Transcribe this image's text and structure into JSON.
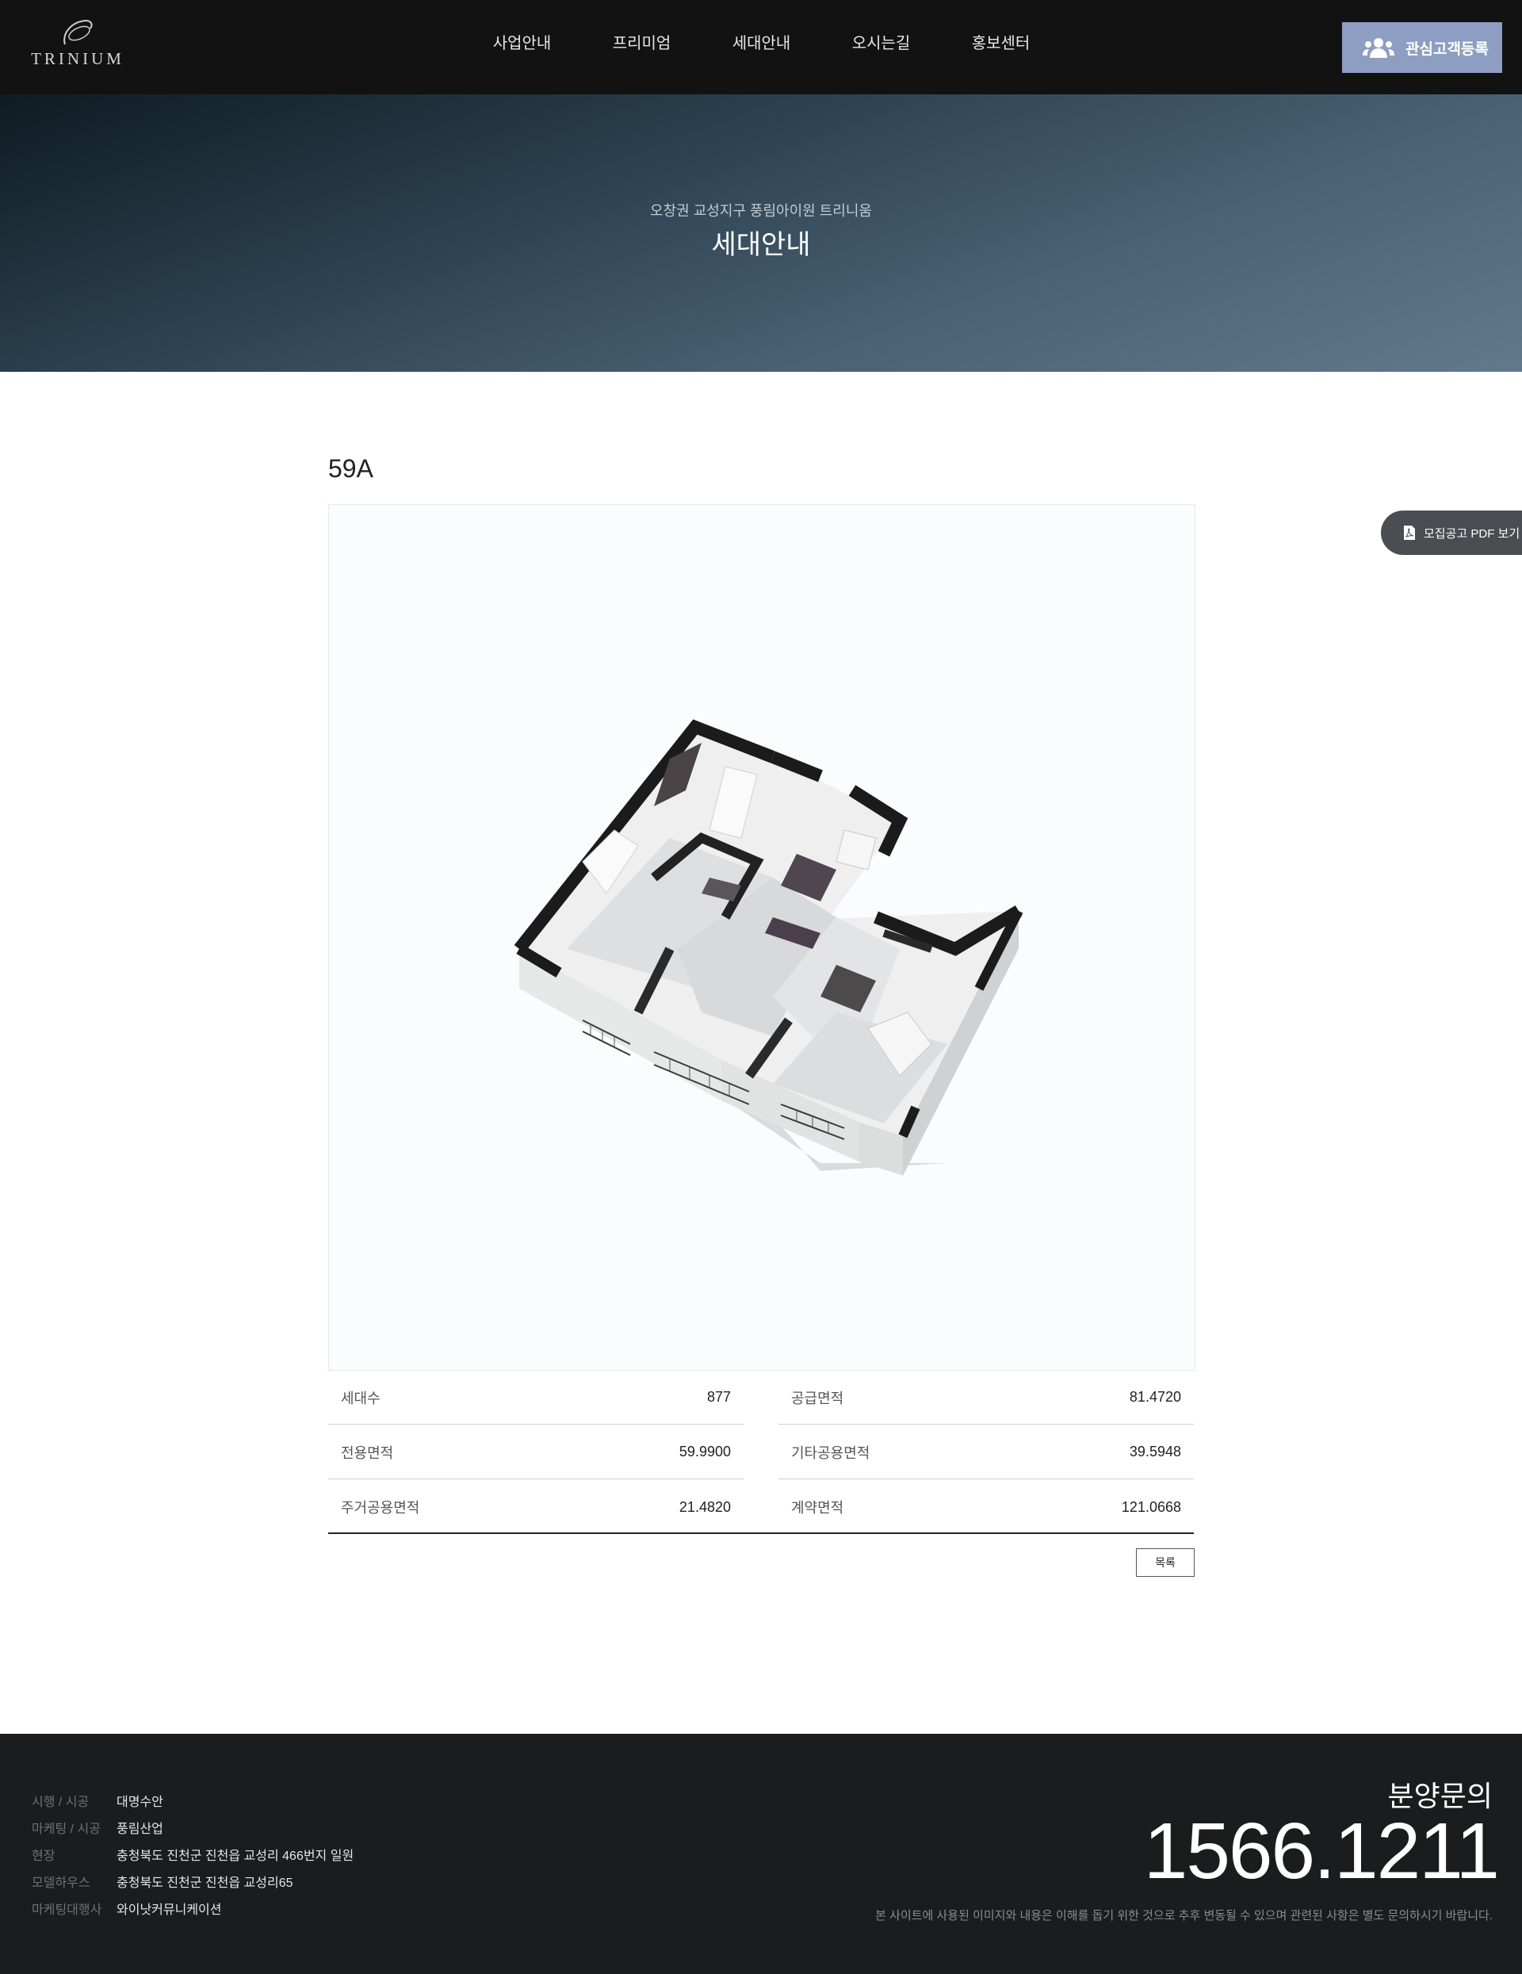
{
  "header": {
    "logo_text": "TRINIUM",
    "nav": [
      "사업안내",
      "프리미엄",
      "세대안내",
      "오시는길",
      "홍보센터"
    ],
    "register_label": "관심고객등록"
  },
  "hero": {
    "subtitle": "오창권 교성지구 풍림아이원 트리니움",
    "title": "세대안내"
  },
  "side": {
    "pdf_label": "모집공고 PDF 보기"
  },
  "main": {
    "unit_title": "59A",
    "floorplan_icon": "floorplan-3d-image",
    "specs": [
      {
        "label": "세대수",
        "value": "877"
      },
      {
        "label": "공급면적",
        "value": "81.4720"
      },
      {
        "label": "전용면적",
        "value": "59.9900"
      },
      {
        "label": "기타공용면적",
        "value": "39.5948"
      },
      {
        "label": "주거공용면적",
        "value": "21.4820"
      },
      {
        "label": "계약면적",
        "value": "121.0668"
      }
    ],
    "list_button": "목록"
  },
  "footer": {
    "info": [
      {
        "key": "시행 / 시공",
        "value": "대명수안"
      },
      {
        "key": "마케팅 / 시공",
        "value": "풍림산업"
      },
      {
        "key": "현장",
        "value": "충청북도 진천군 진천읍 교성리 466번지 일원"
      },
      {
        "key": "모델하우스",
        "value": "충청북도 진천군 진천읍 교성리65"
      },
      {
        "key": "마케팅대행사",
        "value": "와이낫커뮤니케이션"
      }
    ],
    "contact_label": "분양문의",
    "phone": "1566.1211",
    "disclaimer": "본 사이트에 사용된 이미지와 내용은 이해를 돕기 위한 것으로 추후 변동될 수 있으며 관련된 사항은 별도 문의하시기 바랍니다."
  },
  "colors": {
    "header_bg": "#121212",
    "accent_button": "#8e9ec2",
    "footer_bg": "#1a1c1e",
    "pdf_button": "#4a4d51"
  }
}
